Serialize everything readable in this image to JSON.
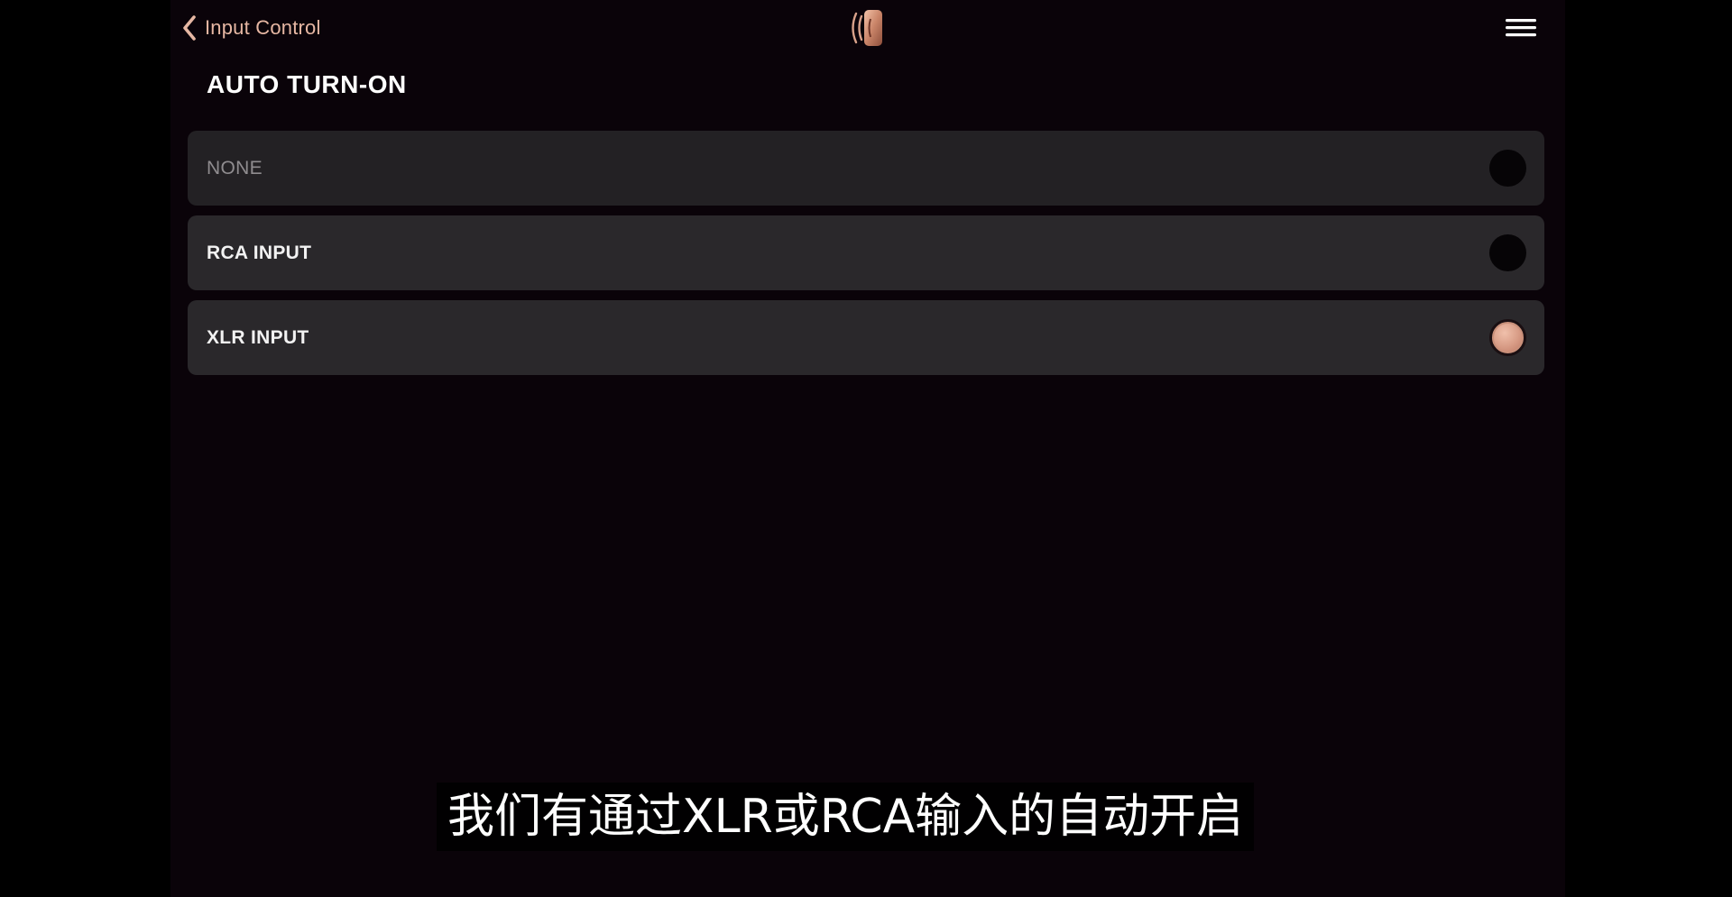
{
  "nav": {
    "back_label": "Input Control",
    "back_icon": "chevron-left-icon",
    "logo_icon": "brand-logo",
    "menu_icon": "hamburger-menu-icon"
  },
  "page": {
    "title": "AUTO TURN-ON"
  },
  "options": [
    {
      "label": "NONE",
      "selected": false
    },
    {
      "label": "RCA INPUT",
      "selected": false
    },
    {
      "label": "XLR INPUT",
      "selected": true
    }
  ],
  "subtitle": {
    "text": "我们有通过XLR或RCA输入的自动开启"
  },
  "colors": {
    "accent": "#e6b7a3",
    "radio_selected": "#d89c86",
    "background": "#0a0309",
    "card": "#2a282b"
  }
}
